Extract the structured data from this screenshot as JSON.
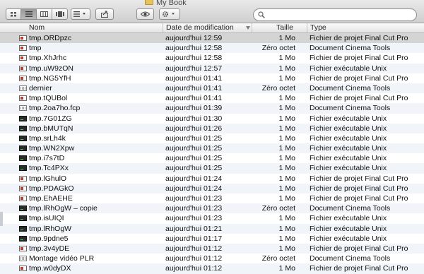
{
  "window": {
    "title": "My Book"
  },
  "toolbar": {
    "view_buttons": [
      {
        "name": "icon-view-button",
        "icon": "icon-grid-icon",
        "active": false
      },
      {
        "name": "list-view-button",
        "icon": "list-icon",
        "active": true
      },
      {
        "name": "column-view-button",
        "icon": "columns-icon",
        "active": false
      },
      {
        "name": "coverflow-view-button",
        "icon": "coverflow-icon",
        "active": false
      }
    ],
    "arrange_icon": "arrange-menu-icon",
    "share_icon": "share-icon",
    "quicklook_icon": "eye-icon",
    "action_icon": "gear-icon"
  },
  "search": {
    "value": "",
    "placeholder": "",
    "icon": "magnifier-icon"
  },
  "columns": {
    "name": "Nom",
    "date": "Date de modification",
    "size": "Taille",
    "type": "Type"
  },
  "files": [
    {
      "name": "tmp.ORDpzc",
      "date": "aujourd'hui 12:59",
      "size": "1 Mo",
      "type": "Fichier de projet Final Cut Pro",
      "icon": "fcp",
      "selected": true
    },
    {
      "name": "tmp",
      "date": "aujourd'hui 12:58",
      "size": "Zéro octet",
      "type": "Document Cinema Tools",
      "icon": "fcp"
    },
    {
      "name": "tmp.XhJrhc",
      "date": "aujourd'hui 12:58",
      "size": "1 Mo",
      "type": "Fichier de projet Final Cut Pro",
      "icon": "fcp"
    },
    {
      "name": "tmp.uW9zON",
      "date": "aujourd'hui 12:57",
      "size": "1 Mo",
      "type": "Fichier exécutable Unix",
      "icon": "fcp"
    },
    {
      "name": "tmp.NG5YfH",
      "date": "aujourd'hui 01:41",
      "size": "1 Mo",
      "type": "Fichier de projet Final Cut Pro",
      "icon": "fcp"
    },
    {
      "name": "dernier",
      "date": "aujourd'hui 01:41",
      "size": "Zéro octet",
      "type": "Document Cinema Tools",
      "icon": "cinema"
    },
    {
      "name": "tmp.tQUBol",
      "date": "aujourd'hui 01:41",
      "size": "1 Mo",
      "type": "Fichier de projet Final Cut Pro",
      "icon": "fcp"
    },
    {
      "name": "tmp.2oa7ho.fcp",
      "date": "aujourd'hui 01:39",
      "size": "1 Mo",
      "type": "Document Cinema Tools",
      "icon": "cinema"
    },
    {
      "name": "tmp.7G01ZG",
      "date": "aujourd'hui 01:30",
      "size": "1 Mo",
      "type": "Fichier exécutable Unix",
      "icon": "exec"
    },
    {
      "name": "tmp.bMUTqN",
      "date": "aujourd'hui 01:26",
      "size": "1 Mo",
      "type": "Fichier exécutable Unix",
      "icon": "exec"
    },
    {
      "name": "tmp.srLh4k",
      "date": "aujourd'hui 01:25",
      "size": "1 Mo",
      "type": "Fichier exécutable Unix",
      "icon": "exec"
    },
    {
      "name": "tmp.WN2Xpw",
      "date": "aujourd'hui 01:25",
      "size": "1 Mo",
      "type": "Fichier exécutable Unix",
      "icon": "exec"
    },
    {
      "name": "tmp.i7s7tD",
      "date": "aujourd'hui 01:25",
      "size": "1 Mo",
      "type": "Fichier exécutable Unix",
      "icon": "exec"
    },
    {
      "name": "tmp.Tc4PXx",
      "date": "aujourd'hui 01:25",
      "size": "1 Mo",
      "type": "Fichier exécutable Unix",
      "icon": "exec"
    },
    {
      "name": "tmp.lGhulO",
      "date": "aujourd'hui 01:24",
      "size": "1 Mo",
      "type": "Fichier de projet Final Cut Pro",
      "icon": "fcp"
    },
    {
      "name": "tmp.PDAGkO",
      "date": "aujourd'hui 01:24",
      "size": "1 Mo",
      "type": "Fichier de projet Final Cut Pro",
      "icon": "fcp"
    },
    {
      "name": "tmp.EhAEHE",
      "date": "aujourd'hui 01:23",
      "size": "1 Mo",
      "type": "Fichier de projet Final Cut Pro",
      "icon": "fcp"
    },
    {
      "name": "tmp.lRhOgW – copie",
      "date": "aujourd'hui 01:23",
      "size": "Zéro octet",
      "type": "Document Cinema Tools",
      "icon": "exec"
    },
    {
      "name": "tmp.isUIQI",
      "date": "aujourd'hui 01:23",
      "size": "1 Mo",
      "type": "Fichier exécutable Unix",
      "icon": "exec"
    },
    {
      "name": "tmp.lRhOgW",
      "date": "aujourd'hui 01:21",
      "size": "1 Mo",
      "type": "Fichier exécutable Unix",
      "icon": "exec"
    },
    {
      "name": "tmp.9pdne5",
      "date": "aujourd'hui 01:17",
      "size": "1 Mo",
      "type": "Fichier exécutable Unix",
      "icon": "exec"
    },
    {
      "name": "tmp.3v4yDE",
      "date": "aujourd'hui 01:12",
      "size": "1 Mo",
      "type": "Fichier de projet Final Cut Pro",
      "icon": "fcp"
    },
    {
      "name": "Montage vidéo PLR",
      "date": "aujourd'hui 01:12",
      "size": "Zéro octet",
      "type": "Document Cinema Tools",
      "icon": "cinema"
    },
    {
      "name": "tmp.w0dyDX",
      "date": "aujourd'hui 01:12",
      "size": "1 Mo",
      "type": "Fichier de projet Final Cut Pro",
      "icon": "fcp"
    }
  ]
}
